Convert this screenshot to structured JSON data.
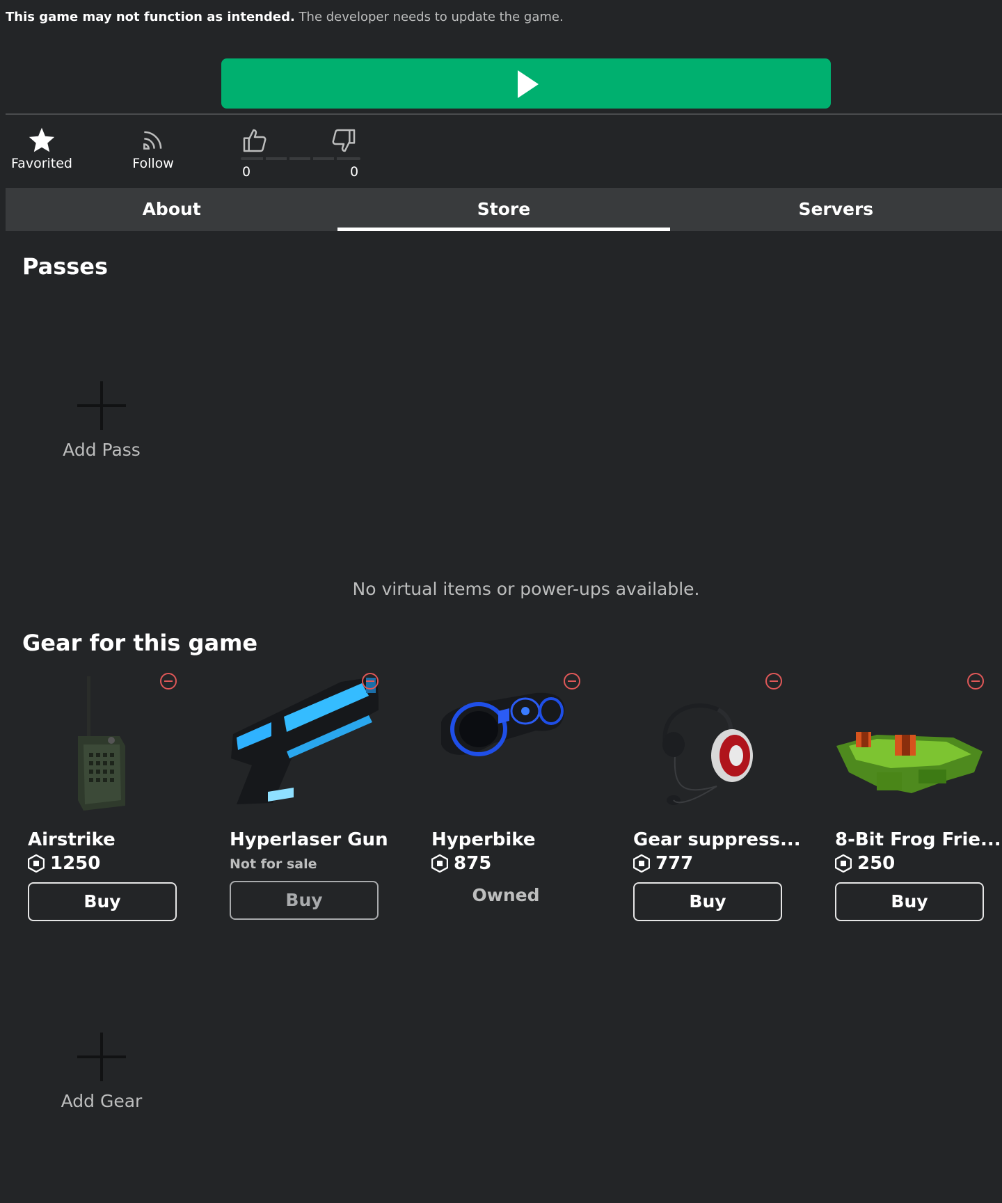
{
  "warning": {
    "strong": "This game may not function as intended.",
    "rest": "The developer needs to update the game."
  },
  "actions": {
    "favorite_label": "Favorited",
    "follow_label": "Follow",
    "upvotes": "0",
    "downvotes": "0"
  },
  "tabs": [
    {
      "label": "About",
      "active": false
    },
    {
      "label": "Store",
      "active": true
    },
    {
      "label": "Servers",
      "active": false
    }
  ],
  "passes": {
    "title": "Passes",
    "add_label": "Add Pass",
    "empty_message": "No virtual items or power-ups available."
  },
  "gear": {
    "title": "Gear for this game",
    "add_label": "Add Gear",
    "items": [
      {
        "name": "Airstrike",
        "price": "1250",
        "action": "Buy",
        "icon": "walkie-talkie-gear"
      },
      {
        "name": "Hyperlaser Gun",
        "status": "Not for sale",
        "action": "Buy",
        "icon": "laser-gun-gear"
      },
      {
        "name": "Hyperbike",
        "price": "875",
        "status": "Owned",
        "icon": "hover-bike-gear"
      },
      {
        "name": "Gear suppress...",
        "price": "777",
        "action": "Buy",
        "icon": "headset-gear"
      },
      {
        "name": "8-Bit Frog Frie...",
        "price": "250",
        "action": "Buy",
        "icon": "pixel-frog-gear"
      }
    ]
  },
  "colors": {
    "background": "#232527",
    "play_button": "#00b06f",
    "tab_bar": "#393b3d",
    "remove_icon": "#e05858"
  }
}
